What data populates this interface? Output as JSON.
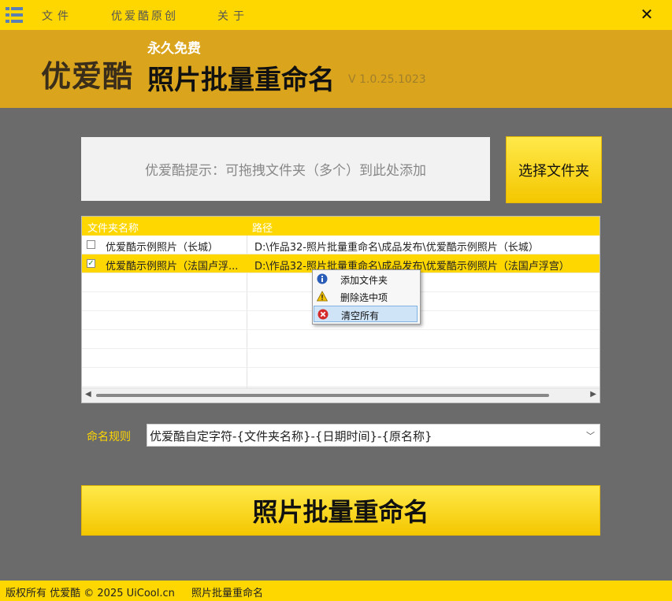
{
  "menu": {
    "file": "文件",
    "original": "优爱酷原创",
    "about": "关于",
    "close_glyph": "✕"
  },
  "header": {
    "logo_text": "优爱酷",
    "free_text": "永久免费",
    "title": "照片批量重命名",
    "version": "V 1.0.25.1023"
  },
  "drop_hint": "优爱酷提示：可拖拽文件夹（多个）到此处添加",
  "choose_folder_button": "选择文件夹",
  "table": {
    "columns": [
      "文件夹名称",
      "路径"
    ],
    "rows": [
      {
        "checked": false,
        "name": "优爱酷示例照片（长城）",
        "path": "D:\\作品32-照片批量重命名\\成品发布\\优爱酷示例照片（长城）"
      },
      {
        "checked": true,
        "name": "优爱酷示例照片（法国卢浮...",
        "path": "D:\\作品32-照片批量重命名\\成品发布\\优爱酷示例照片（法国卢浮宫）"
      }
    ],
    "check_glyph": "✓"
  },
  "context_menu": {
    "items": [
      {
        "label": "添加文件夹",
        "icon": "info-icon"
      },
      {
        "label": "删除选中项",
        "icon": "warning-icon"
      },
      {
        "label": "清空所有",
        "icon": "error-icon"
      }
    ]
  },
  "rule": {
    "label": "命名规则",
    "value": "优爱酷自定字符-{文件夹名称}-{日期时间}-{原名称}"
  },
  "run_button": "照片批量重命名",
  "footer": {
    "copyright": "版权所有 优爱酷 © 2025 UiCool.cn",
    "app_name": "照片批量重命名"
  },
  "colors": {
    "accent": "#ffd700",
    "header_bg": "#daa51d",
    "background": "#6b6b6b"
  }
}
